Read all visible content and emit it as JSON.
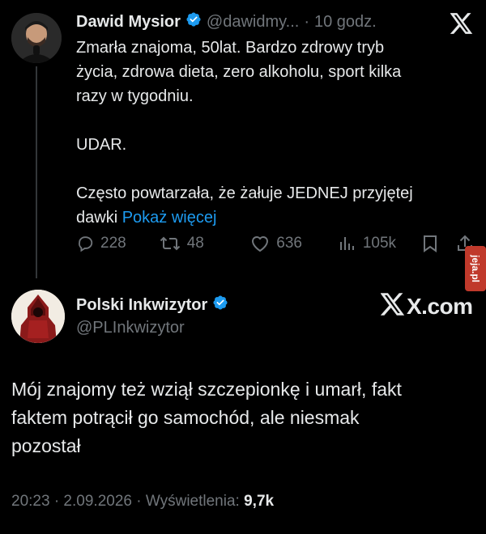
{
  "reply_tweet": {
    "display_name": "Dawid Mysior",
    "handle": "@dawidmy...",
    "time_sep": "·",
    "time": "10 godz.",
    "text_lines": [
      "Zmarła znajoma, 50lat. Bardzo zdrowy tryb",
      "życia,  zdrowa dieta, zero alkoholu, sport kilka",
      "razy w tygodniu.",
      "",
      "UDAR.",
      "",
      "Często powtarzała, że żałuje JEDNEJ przyjętej"
    ],
    "last_line_prefix": "dawki",
    "show_more": "Pokaż więcej",
    "actions": {
      "replies": "228",
      "retweets": "48",
      "likes": "636",
      "views": "105k"
    }
  },
  "main_tweet": {
    "display_name": "Polski Inkwizytor",
    "handle": "@PLInkwizytor",
    "text_lines": [
      "Mój znajomy też wziął szczepionkę i umarł, fakt",
      "faktem potrącił go samochód, ale niesmak",
      "pozostał"
    ],
    "timestamp": "20:23 · 2.09.2026 · Wyświetlenia:",
    "views": "9,7k"
  },
  "brand": {
    "x_logo": "x-logo",
    "xcom": "X.com"
  },
  "watermark": "jeja.pl",
  "colors": {
    "background": "#000000",
    "text": "#e7e9ea",
    "muted": "#71767b",
    "link": "#1d9bf0",
    "verified": "#1d9bf0",
    "watermark": "#c0392b"
  }
}
